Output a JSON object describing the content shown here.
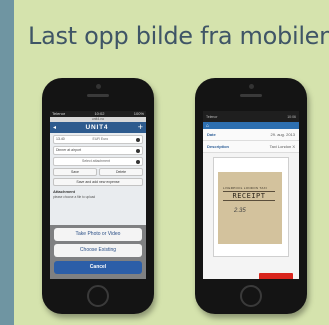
{
  "headline": "Last opp bilde fra mobilen",
  "phone1": {
    "status": {
      "carrier": "Telenor",
      "time": "10:02",
      "battery": "100%"
    },
    "url": "unit4.no",
    "brand": "UNIT4",
    "rows": [
      {
        "label": "13.40",
        "value": "EUR Euro"
      },
      {
        "label": "Dinner at airport",
        "value": ""
      },
      {
        "label": "",
        "value": "Select attachment"
      }
    ],
    "buttons": {
      "save": "Save",
      "delete": "Delete",
      "save_add": "Save and add new expense"
    },
    "attachment_label": "Attachment",
    "attachment_hint": "please choose a file to upload",
    "sheet": {
      "take_photo": "Take Photo or Video",
      "choose_existing": "Choose Existing",
      "cancel": "Cancel"
    }
  },
  "phone2": {
    "status": {
      "carrier": "Telenor",
      "time": "10:06"
    },
    "rows": [
      {
        "key": "Date",
        "value": "29. aug. 2013"
      },
      {
        "key": "Description",
        "value": "Taxi London X"
      }
    ],
    "receipt": {
      "small": "LIVERPOOL LONDON TAXI",
      "big": "RECEIPT",
      "sig": "2.35"
    }
  },
  "colors": {
    "slide_bg": "#d5e3ad",
    "accent": "#2e5b8e",
    "cancel": "#2c5ea8",
    "red": "#d9251d"
  }
}
